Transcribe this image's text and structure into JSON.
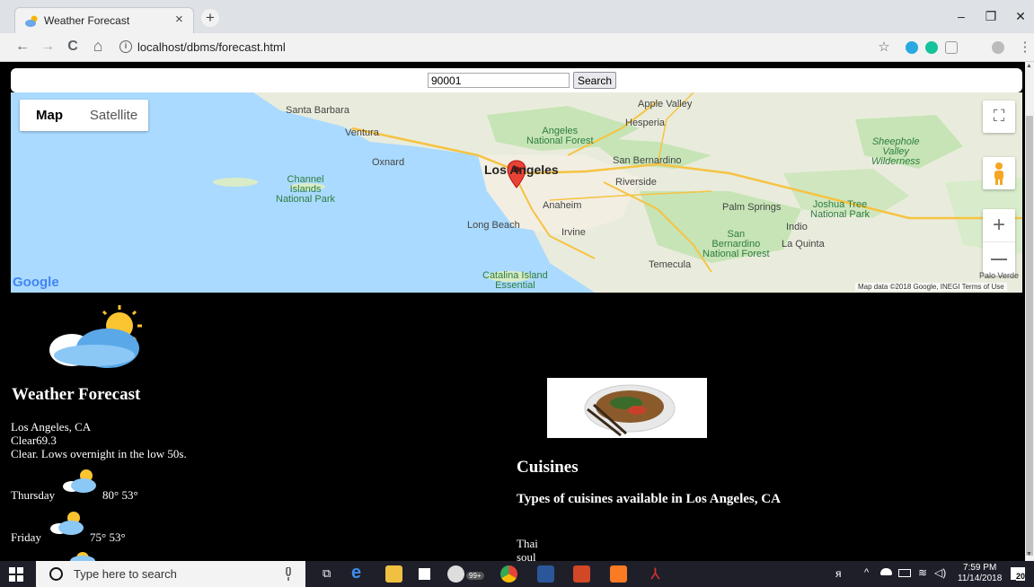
{
  "browser": {
    "tab_title": "Weather Forecast",
    "tab_close": "×",
    "new_tab": "+",
    "url": "localhost/dbms/forecast.html",
    "minimize": "–",
    "restore": "❐",
    "close": "✕",
    "back": "←",
    "forward": "→",
    "reload": "C",
    "home": "⌂",
    "info": "i",
    "star": "☆",
    "menu": "⋮"
  },
  "search": {
    "zip_value": "90001",
    "button_label": "Search"
  },
  "map": {
    "map_button": "Map",
    "satellite_button": "Satellite",
    "fullscreen": "⛶",
    "zoom_in": "+",
    "zoom_out": "—",
    "google": "Google",
    "attribution": "Map data ©2018 Google, INEGI   Terms of Use",
    "labels": {
      "santa_barbara": "Santa Barbara",
      "ventura": "Ventura",
      "oxnard": "Oxnard",
      "los_angeles": "Los Angeles",
      "angeles_nf": "Angeles\nNational Forest",
      "apple_valley": "Apple Valley",
      "hesperia": "Hesperia",
      "san_bernardino": "San Bernardino",
      "riverside": "Riverside",
      "anaheim": "Anaheim",
      "long_beach": "Long Beach",
      "irvine": "Irvine",
      "palm_springs": "Palm Springs",
      "indio": "Indio",
      "la_quinta": "La Quinta",
      "joshua_tree": "Joshua Tree\nNational Park",
      "sheephole": "Sheephole\nValley\nWilderness",
      "channel_islands": "Channel\nIslands\nNational Park",
      "san_bernardino_nf": "San\nBernardino\nNational Forest",
      "temecula": "Temecula",
      "catalina": "Catalina Island\nEssential",
      "palo_verde": "Palo Verde"
    }
  },
  "weather": {
    "title": "Weather Forecast",
    "location": "Los Angeles, CA",
    "current": "Clear69.3",
    "summary": "Clear. Lows overnight in the low 50s.",
    "days": [
      {
        "day": "Thursday",
        "temps": "80° 53°"
      },
      {
        "day": "Friday",
        "temps": "75° 53°"
      }
    ]
  },
  "cuisine": {
    "title": "Cuisines",
    "subtitle": "Types of cuisines available in Los Angeles, CA",
    "items": [
      "Thai",
      "soul"
    ]
  },
  "taskbar": {
    "search_placeholder": "Type here to search",
    "badge": "99+",
    "time": "7:59 PM",
    "date": "11/14/2018",
    "notifications": "20"
  },
  "colors": {
    "google_blue": "#4285f4",
    "google_red": "#ea4335",
    "google_yellow": "#fbbc05",
    "google_green": "#34a853"
  }
}
